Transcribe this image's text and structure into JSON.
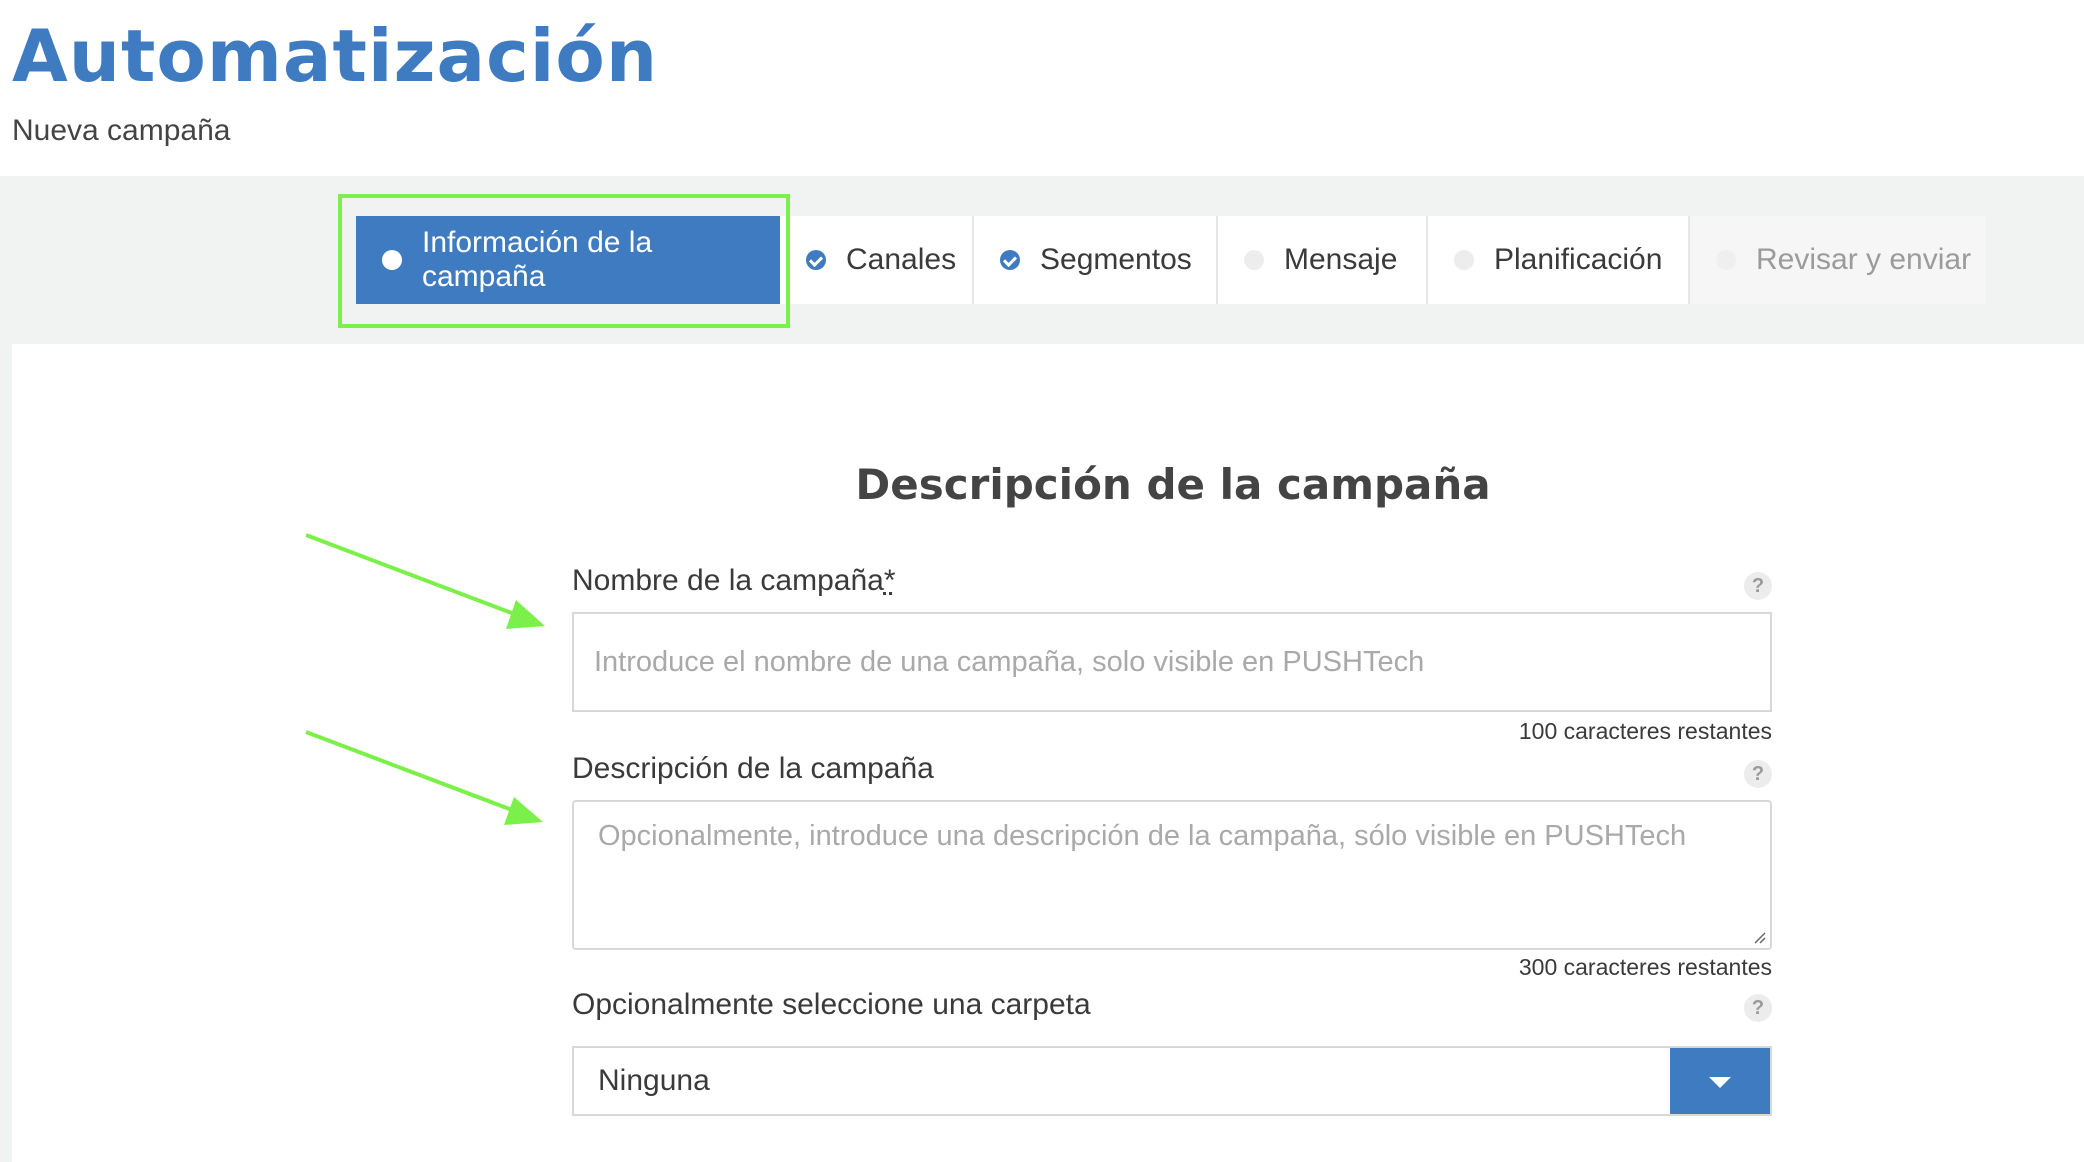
{
  "app": {
    "title": "Automatización",
    "subtitle": "Nueva campaña"
  },
  "steps": [
    {
      "label": "Información de la campaña",
      "state": "active"
    },
    {
      "label": "Canales",
      "state": "completed"
    },
    {
      "label": "Segmentos",
      "state": "completed"
    },
    {
      "label": "Mensaje",
      "state": "pending"
    },
    {
      "label": "Planificación",
      "state": "pending"
    },
    {
      "label": "Revisar y enviar",
      "state": "disabled"
    }
  ],
  "form": {
    "section_title": "Descripción de la campaña",
    "name": {
      "label": "Nombre de la campaña",
      "required_mark": "*",
      "placeholder": "Introduce el nombre de una campaña, solo visible en PUSHTech",
      "value": "",
      "counter": "100 caracteres restantes",
      "help": "?"
    },
    "description": {
      "label": "Descripción de la campaña",
      "placeholder": "Opcionalmente, introduce una descripción de la campaña, sólo visible en PUSHTech",
      "value": "",
      "counter": "300 caracteres restantes",
      "help": "?"
    },
    "folder": {
      "label": "Opcionalmente seleccione una carpeta",
      "selected": "Ninguna",
      "help": "?"
    }
  },
  "colors": {
    "accent": "#3f7bc1",
    "annotation": "#7cf04a",
    "band": "#f1f2f2"
  }
}
